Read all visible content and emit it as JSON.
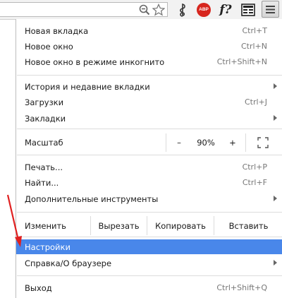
{
  "toolbar": {
    "icons": [
      "zoom-icon",
      "star-icon",
      "music-extension-icon",
      "adblock-plus-icon",
      "formula-extension-icon",
      "reader-extension-icon",
      "hamburger-menu-icon"
    ],
    "abp_label": "ABP",
    "fx_label": "f?"
  },
  "menu": {
    "new_tab": {
      "label": "Новая вкладка",
      "shortcut": "Ctrl+T"
    },
    "new_window": {
      "label": "Новое окно",
      "shortcut": "Ctrl+N"
    },
    "incognito": {
      "label": "Новое окно в режиме инкогнито",
      "shortcut": "Ctrl+Shift+N"
    },
    "history": {
      "label": "История и недавние вкладки"
    },
    "downloads": {
      "label": "Загрузки",
      "shortcut": "Ctrl+J"
    },
    "bookmarks": {
      "label": "Закладки"
    },
    "zoom": {
      "label": "Масштаб",
      "minus": "–",
      "value": "90%",
      "plus": "+"
    },
    "print": {
      "label": "Печать...",
      "shortcut": "Ctrl+P"
    },
    "find": {
      "label": "Найти...",
      "shortcut": "Ctrl+F"
    },
    "more_tools": {
      "label": "Дополнительные инструменты"
    },
    "edit": {
      "label": "Изменить",
      "cut": "Вырезать",
      "copy": "Копировать",
      "paste": "Вставить"
    },
    "settings": {
      "label": "Настройки"
    },
    "help": {
      "label": "Справка/О браузере"
    },
    "exit": {
      "label": "Выход",
      "shortcut": "Ctrl+Shift+Q"
    }
  },
  "colors": {
    "highlight": "#4987ea",
    "annotation_arrow": "#e02020",
    "abp": "#d7261e"
  }
}
